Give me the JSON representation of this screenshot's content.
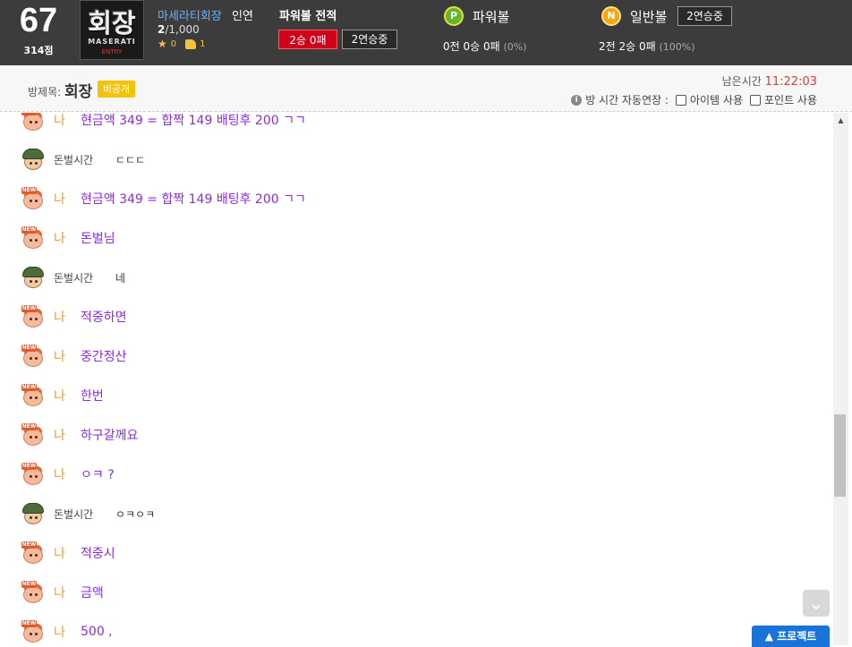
{
  "profile": {
    "level": "67",
    "points": "314점",
    "avatar_text": "회장",
    "avatar_sub": "MASERATI",
    "avatar_sub2": "ENTRY",
    "name": "마세라티회장",
    "relation": "인연",
    "rank_current": "2",
    "rank_total": "/1,000",
    "stars": "0",
    "likes": "1"
  },
  "powerball_record": {
    "title": "파워볼 전적",
    "result_badge": "2승 0패",
    "streak_badge": "2연승중"
  },
  "powerball": {
    "coin": "P",
    "label": "파워볼",
    "record": "0전 0승 0패",
    "pct": "(0%)"
  },
  "normalball": {
    "coin": "N",
    "label": "일반볼",
    "streak": "2연승중",
    "record": "2전 2승 0패",
    "pct": "(100%)"
  },
  "room": {
    "label": "방제목:",
    "name": "회장",
    "private_tag": "비공개",
    "time_label": "남은시간",
    "time_value": "11:22:03",
    "auto_extend": "방 시간 자동연장 :",
    "item_use": "아이템 사용",
    "point_use": "포인트 사용"
  },
  "messages": [
    {
      "sender": "나",
      "text": "현금액 349 = 합짝 149 배팅후 200 ㄱㄱ",
      "me": true
    },
    {
      "sender": "돈벌시간",
      "text": "ㄷㄷㄷ",
      "me": false
    },
    {
      "sender": "나",
      "text": "현금액 349 = 합짝 149 배팅후 200 ㄱㄱ",
      "me": true
    },
    {
      "sender": "나",
      "text": "돈벌님",
      "me": true
    },
    {
      "sender": "돈벌시간",
      "text": "네",
      "me": false
    },
    {
      "sender": "나",
      "text": "적중하면",
      "me": true
    },
    {
      "sender": "나",
      "text": "중간정산",
      "me": true
    },
    {
      "sender": "나",
      "text": "한번",
      "me": true
    },
    {
      "sender": "나",
      "text": "하구갈께요",
      "me": true
    },
    {
      "sender": "나",
      "text": "ㅇㅋ ?",
      "me": true
    },
    {
      "sender": "돈벌시간",
      "text": "ㅇㅋㅇㅋ",
      "me": false
    },
    {
      "sender": "나",
      "text": "적중시",
      "me": true
    },
    {
      "sender": "나",
      "text": "금액",
      "me": true
    },
    {
      "sender": "나",
      "text": "500 ,",
      "me": true
    }
  ],
  "protect_button": "프로젝트",
  "icons": {
    "new_user": "new-user-icon",
    "soldier": "soldier-avatar-icon",
    "scroll_down": "chevron-down-icon",
    "info": "info-icon"
  },
  "colors": {
    "header_bg": "#3c3c3c",
    "my_text": "#8a2be2",
    "my_sender": "#ff9900",
    "time_red": "#e03838",
    "badge_red": "#d0021b",
    "private_tag": "#f4c20d",
    "protect_blue": "#1a73d9"
  }
}
